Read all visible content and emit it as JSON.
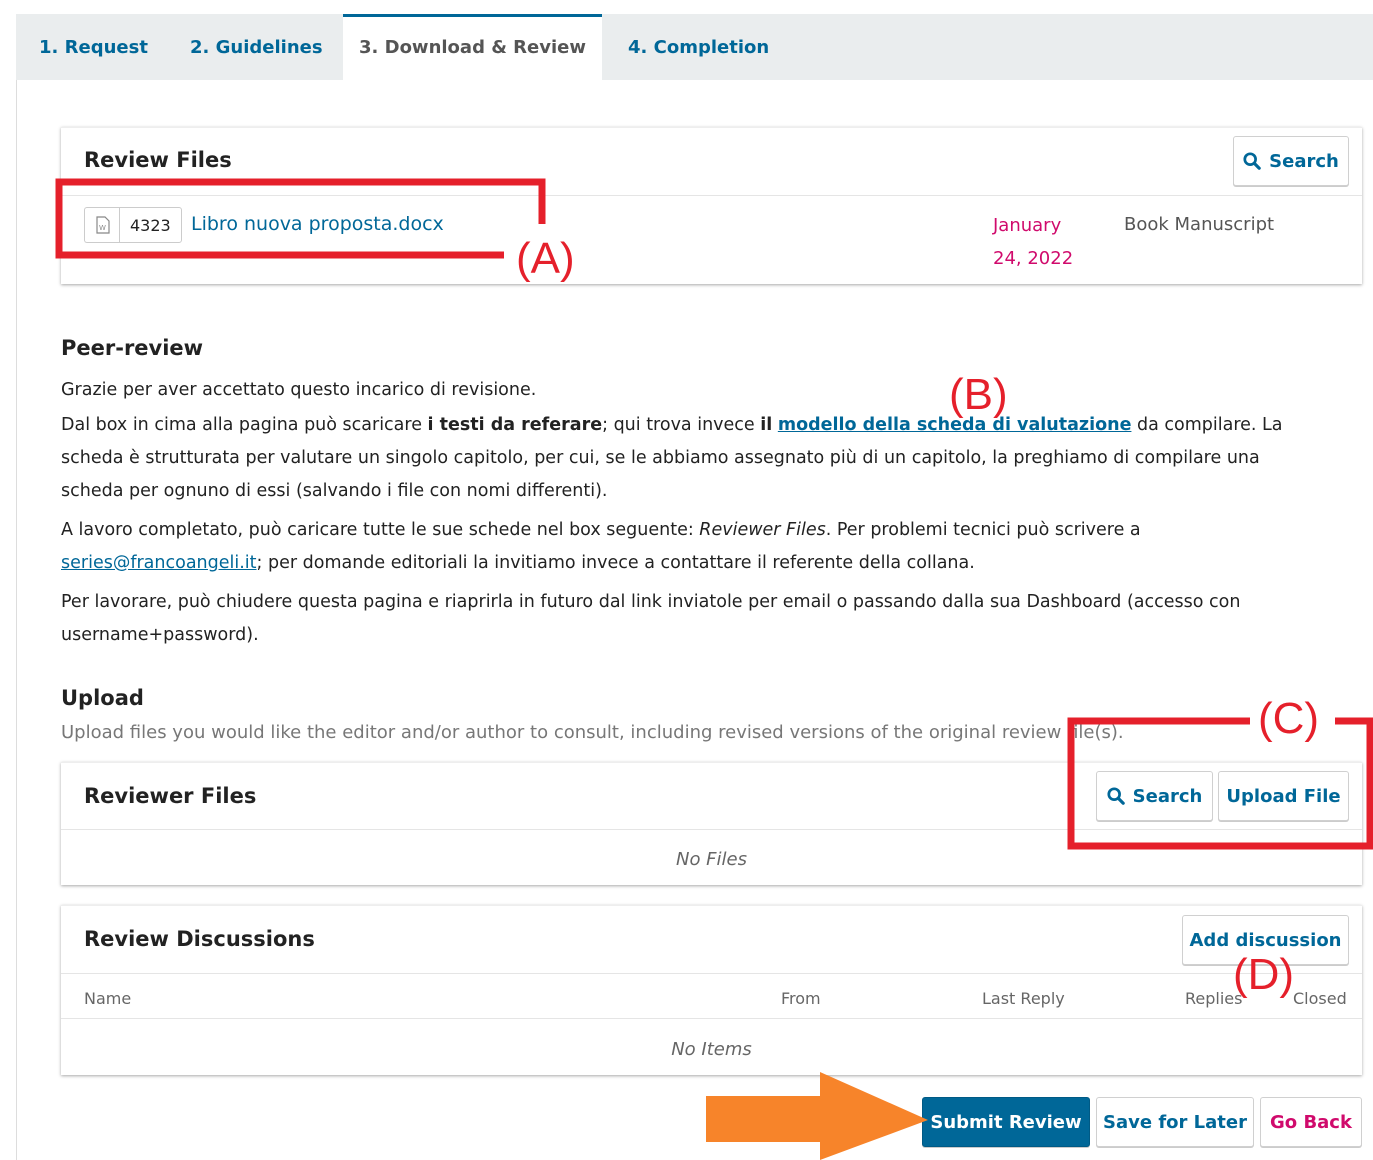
{
  "tabs": [
    {
      "label": "1. Request"
    },
    {
      "label": "2. Guidelines"
    },
    {
      "label": "3. Download & Review"
    },
    {
      "label": "4. Completion"
    }
  ],
  "review_files": {
    "title": "Review Files",
    "search_label": "Search",
    "file": {
      "id": "4323",
      "name": "Libro nuova proposta.docx",
      "date_line1": "January",
      "date_line2": "24, 2022",
      "type": "Book Manuscript"
    }
  },
  "peer_review": {
    "title": "Peer-review",
    "line1": "Grazie per aver accettato questo incarico di revisione.",
    "p2_a": "Dal box in cima alla pagina può scaricare ",
    "p2_bold1": "i testi da referare",
    "p2_b": "; qui trova invece ",
    "p2_bold2": "il",
    "p2_link": "modello della scheda di valutazione",
    "p2_c": " da compilare. La scheda è strutturata per valutare un singolo capitolo, per cui, se le abbiamo assegnato più di un capitolo, la preghiamo di compilare una scheda per ognuno di essi (salvando i file con nomi differenti).",
    "p3_a": "A lavoro completato, può caricare tutte le sue schede nel box seguente: ",
    "p3_em": "Reviewer Files",
    "p3_b": ". Per problemi tecnici può scrivere a ",
    "p3_email": "series@francoangeli.it",
    "p3_c": "; per domande editoriali la invitiamo invece a contattare il referente della collana.",
    "p4": "Per lavorare, può chiudere questa pagina e riaprirla in futuro dal link inviatole per email o passando dalla sua Dashboard (accesso con username+password)."
  },
  "upload": {
    "title": "Upload",
    "description": "Upload files you would like the editor and/or author to consult, including revised versions of the original review file(s)."
  },
  "reviewer_files": {
    "title": "Reviewer Files",
    "search_label": "Search",
    "upload_label": "Upload File",
    "empty": "No Files"
  },
  "review_discussions": {
    "title": "Review Discussions",
    "add_label": "Add discussion",
    "columns": [
      "Name",
      "From",
      "Last Reply",
      "Replies",
      "Closed"
    ],
    "empty": "No Items"
  },
  "actions": {
    "submit": "Submit Review",
    "save": "Save for Later",
    "back": "Go Back"
  },
  "annotations": {
    "a": "(A)",
    "b": "(B)",
    "c": "(C)",
    "d": "(D)",
    "box_color": "#e5202b",
    "arrow_color": "#f7842a"
  },
  "colors": {
    "primary": "#006798",
    "date": "#d00a6c",
    "tabbar": "#eaedee"
  }
}
